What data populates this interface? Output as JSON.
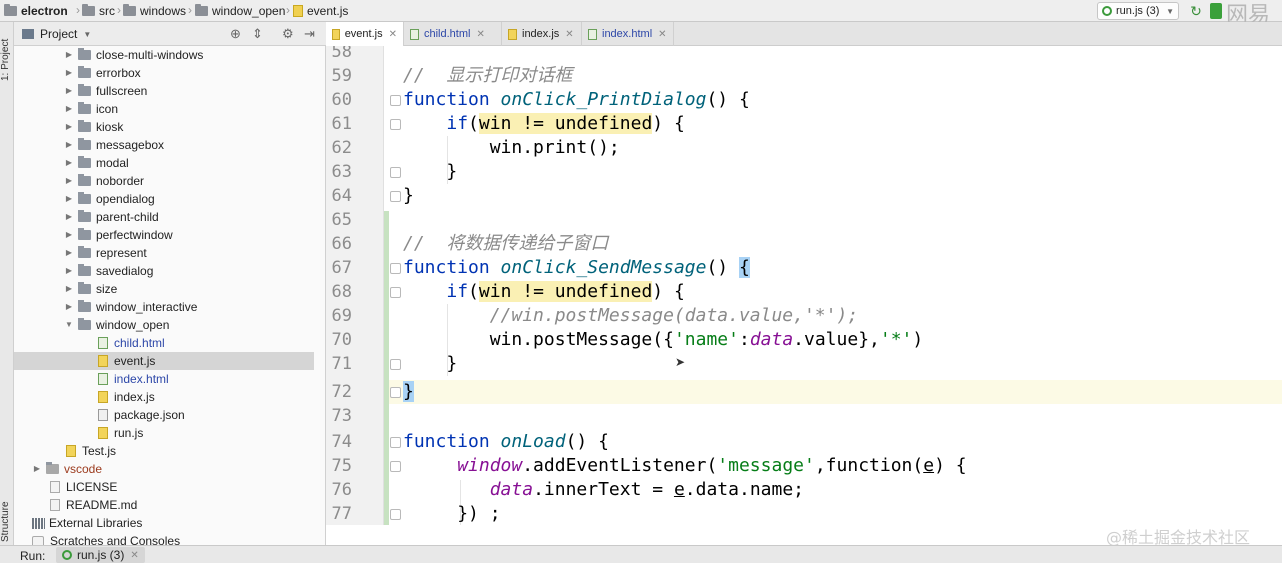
{
  "breadcrumb": [
    "electron",
    "src",
    "windows",
    "window_open",
    "event.js"
  ],
  "run_config": "run.js (3)",
  "watermark_top": "网易",
  "toolstrip": {
    "project_tab": "1: Project",
    "structure_tab": "Structure"
  },
  "project_panel": {
    "title": "Project",
    "rows": [
      {
        "label": "close-multi-windows",
        "kind": "folder"
      },
      {
        "label": "errorbox",
        "kind": "folder"
      },
      {
        "label": "fullscreen",
        "kind": "folder"
      },
      {
        "label": "icon",
        "kind": "folder"
      },
      {
        "label": "kiosk",
        "kind": "folder"
      },
      {
        "label": "messagebox",
        "kind": "folder"
      },
      {
        "label": "modal",
        "kind": "folder"
      },
      {
        "label": "noborder",
        "kind": "folder"
      },
      {
        "label": "opendialog",
        "kind": "folder"
      },
      {
        "label": "parent-child",
        "kind": "folder"
      },
      {
        "label": "perfectwindow",
        "kind": "folder"
      },
      {
        "label": "represent",
        "kind": "folder"
      },
      {
        "label": "savedialog",
        "kind": "folder"
      },
      {
        "label": "size",
        "kind": "folder"
      },
      {
        "label": "window_interactive",
        "kind": "folder"
      },
      {
        "label": "window_open",
        "kind": "folder-open"
      },
      {
        "label": "child.html",
        "kind": "html"
      },
      {
        "label": "event.js",
        "kind": "js"
      },
      {
        "label": "index.html",
        "kind": "html"
      },
      {
        "label": "index.js",
        "kind": "js"
      },
      {
        "label": "package.json",
        "kind": "json"
      },
      {
        "label": "run.js",
        "kind": "js"
      },
      {
        "label": "Test.js",
        "kind": "js"
      },
      {
        "label": "vscode",
        "kind": "folder"
      },
      {
        "label": "LICENSE",
        "kind": "txt"
      },
      {
        "label": "README.md",
        "kind": "txt"
      },
      {
        "label": "External Libraries",
        "kind": "lib"
      },
      {
        "label": "Scratches and Consoles",
        "kind": "scratch"
      }
    ]
  },
  "tabs": [
    {
      "label": "event.js",
      "active": true
    },
    {
      "label": "child.html",
      "active": false
    },
    {
      "label": "index.js",
      "active": false
    },
    {
      "label": "index.html",
      "active": false
    }
  ],
  "editor": {
    "lines": [
      "58",
      "59",
      "60",
      "61",
      "62",
      "63",
      "64",
      "65",
      "66",
      "67",
      "68",
      "69",
      "70",
      "71",
      "72",
      "73",
      "74",
      "75",
      "76",
      "77"
    ],
    "comment_print": "//  显示打印对话框",
    "comment_send": "//  将数据传递给子窗口",
    "kw_function": "function",
    "fn_print": "onClick_PrintDialog",
    "fn_send": "onClick_SendMessage",
    "fn_onload": "onLoad",
    "parens": "()",
    "kw_if": "if",
    "cond": "win != undefined",
    "print_call": "win.print();",
    "post_comment": "//win.postMessage(data.value,'*');",
    "win_word": "win",
    "post_method": ".postMessage({",
    "str_name": "'name'",
    "data_word": "data",
    "value_tail": ".value},",
    "str_star": "'*'",
    "window_word": "window",
    "add_listener": ".addEventListener(",
    "str_message": "'message'",
    "comma_fn": ",function(",
    "param_e": "e",
    "inner_text": ".innerText = ",
    "data_name": ".data.name;",
    "close_77": "}) ;"
  },
  "run_bar": {
    "label": "Run:",
    "tab": "run.js (3)"
  },
  "watermark": "@稀土掘金技术社区"
}
